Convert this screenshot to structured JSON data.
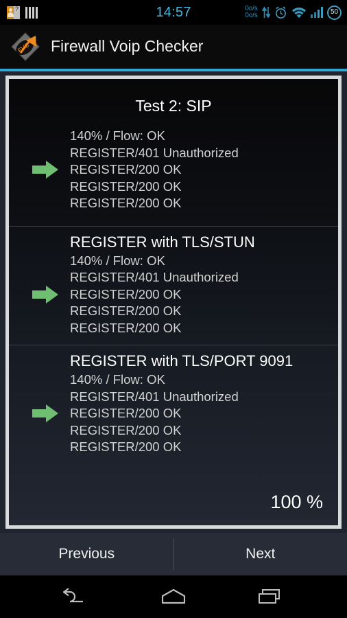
{
  "statusbar": {
    "left_icons": [
      {
        "name": "contact-missing-icon",
        "glyph": "?"
      },
      {
        "name": "sim-bars-icon",
        "glyph": "||||"
      }
    ],
    "clock": "14:57",
    "net_speed_down": "0o/s",
    "net_speed_up": "0o/s",
    "right_icons": [
      {
        "name": "data-transfer-icon"
      },
      {
        "name": "alarm-clock-icon"
      },
      {
        "name": "wifi-icon"
      },
      {
        "name": "cell-signal-icon"
      }
    ],
    "battery_level": "50"
  },
  "actionbar": {
    "app_icon_label": "FVC",
    "title": "Firewall Voip Checker",
    "accent_color": "#2fa8d8"
  },
  "panel": {
    "test_title": "Test 2: SIP",
    "arrow_color": "#6fbf73",
    "sections": [
      {
        "heading": "",
        "lines": [
          "140% / Flow: OK",
          "REGISTER/401 Unauthorized",
          "REGISTER/200 OK",
          "REGISTER/200 OK",
          "REGISTER/200 OK"
        ]
      },
      {
        "heading": "REGISTER with TLS/STUN",
        "lines": [
          "140% / Flow: OK",
          "REGISTER/401 Unauthorized",
          "REGISTER/200 OK",
          "REGISTER/200 OK",
          "REGISTER/200 OK"
        ]
      },
      {
        "heading": "REGISTER with TLS/PORT 9091",
        "lines": [
          "140% / Flow: OK",
          "REGISTER/401 Unauthorized",
          "REGISTER/200 OK",
          "REGISTER/200 OK",
          "REGISTER/200 OK"
        ]
      }
    ],
    "progress_label": "100 %"
  },
  "buttonbar": {
    "previous_label": "Previous",
    "next_label": "Next"
  },
  "navbar": {
    "back_label": "back-icon",
    "home_label": "home-icon",
    "recents_label": "recents-icon"
  }
}
